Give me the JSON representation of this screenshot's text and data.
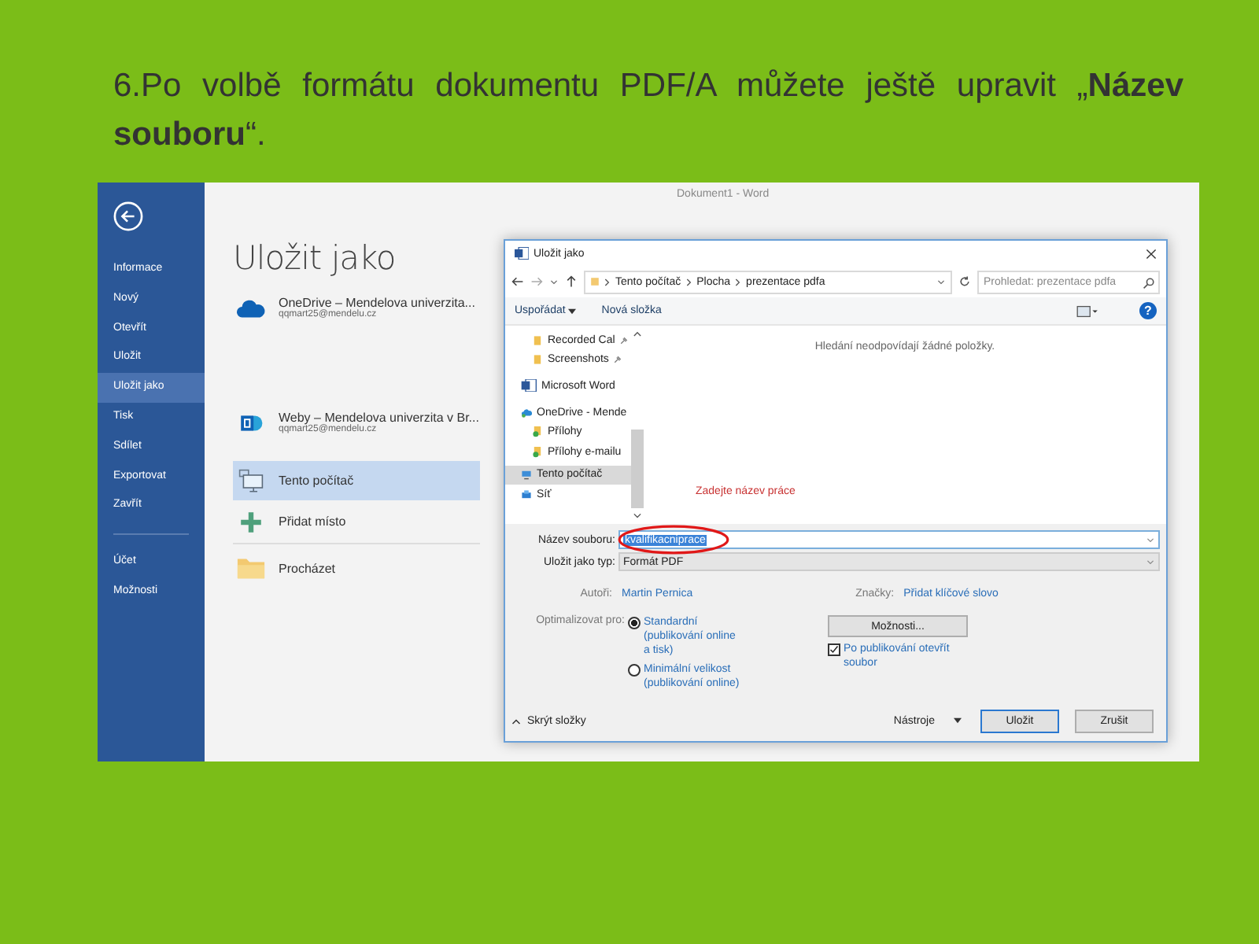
{
  "heading": "6.Po volbě formátu dokumentu PDF/A  můžete ještě upravit „**Název souboru**“.",
  "word": {
    "window_title": "Dokument1 - Word",
    "sidebar": {
      "items": [
        {
          "label": "Informace",
          "selected": false
        },
        {
          "label": "Nový",
          "selected": false
        },
        {
          "label": "Otevřít",
          "selected": false
        },
        {
          "label": "Uložit",
          "selected": false
        },
        {
          "label": "Uložit jako",
          "selected": true
        },
        {
          "label": "Tisk",
          "selected": false
        },
        {
          "label": "Sdílet",
          "selected": false
        },
        {
          "label": "Exportovat",
          "selected": false
        },
        {
          "label": "Zavřít",
          "selected": false
        }
      ],
      "footer_items": [
        {
          "label": "Účet",
          "selected": false
        },
        {
          "label": "Možnosti",
          "selected": false
        }
      ]
    },
    "page_title": "Uložit jako",
    "locations": [
      {
        "kind": "cloud",
        "name": "OneDrive – Mendelova univerzita...",
        "account": "qqmart25@mendelu.cz",
        "selected": false
      },
      {
        "kind": "sharepoint",
        "name": "Weby – Mendelova univerzita v Br...",
        "account": "qqmart25@mendelu.cz",
        "selected": false
      },
      {
        "kind": "computer",
        "name": "Tento počítač",
        "selected": true
      },
      {
        "kind": "add",
        "name": "Přidat místo",
        "selected": false
      },
      {
        "kind": "folder",
        "name": "Procházet",
        "selected": false
      }
    ]
  },
  "dialog": {
    "title": "Uložit jako",
    "path": [
      "Tento počítač",
      "Plocha",
      "prezentace pdfa"
    ],
    "search": {
      "placeholder": "Prohledat: prezentace pdfa"
    },
    "toolbar": [
      "Uspořádat",
      "Nová složka"
    ],
    "help": "?",
    "nav": [
      {
        "kind": "folder",
        "label": "Recorded Cal",
        "pinned": true,
        "selected": false
      },
      {
        "kind": "folder",
        "label": "Screenshots",
        "pinned": true,
        "selected": false
      },
      {
        "kind": "word",
        "label": "Microsoft Word",
        "pinned": false,
        "selected": false
      },
      {
        "kind": "onedrive",
        "label": "OneDrive - Mende",
        "pinned": false,
        "selected": false
      },
      {
        "kind": "synced",
        "label": "Přílohy",
        "pinned": false,
        "selected": false
      },
      {
        "kind": "synced",
        "label": "Přílohy e-mailu",
        "pinned": false,
        "selected": false
      },
      {
        "kind": "computer",
        "label": "Tento počítač",
        "pinned": false,
        "selected": true
      },
      {
        "kind": "network",
        "label": "Síť",
        "pinned": false,
        "selected": false
      }
    ],
    "empty_message": "Hledání neodpovídají žádné položky.",
    "annotation": "Zadejte název práce",
    "filename": {
      "label": "Název souboru:",
      "value": "kvalifikacniprace"
    },
    "filetype": {
      "label": "Uložit jako typ:",
      "value": "Formát PDF"
    },
    "authors": {
      "label": "Autoři:",
      "value": "Martin Pernica"
    },
    "tags": {
      "label": "Značky:",
      "value": "Přidat klíčové slovo"
    },
    "optimize": {
      "label": "Optimalizovat pro:",
      "options": [
        {
          "label": "Standardní (publikování online a tisk)",
          "selected": true
        },
        {
          "label": "Minimální velikost (publikování online)",
          "selected": false
        }
      ]
    },
    "options_button": "Možnosti...",
    "open_after": {
      "label": "Po publikování otevřít soubor",
      "checked": true
    },
    "hide_folders": "Skrýt složky",
    "tools": "Nástroje",
    "save": "Uložit",
    "cancel": "Zrušit"
  }
}
